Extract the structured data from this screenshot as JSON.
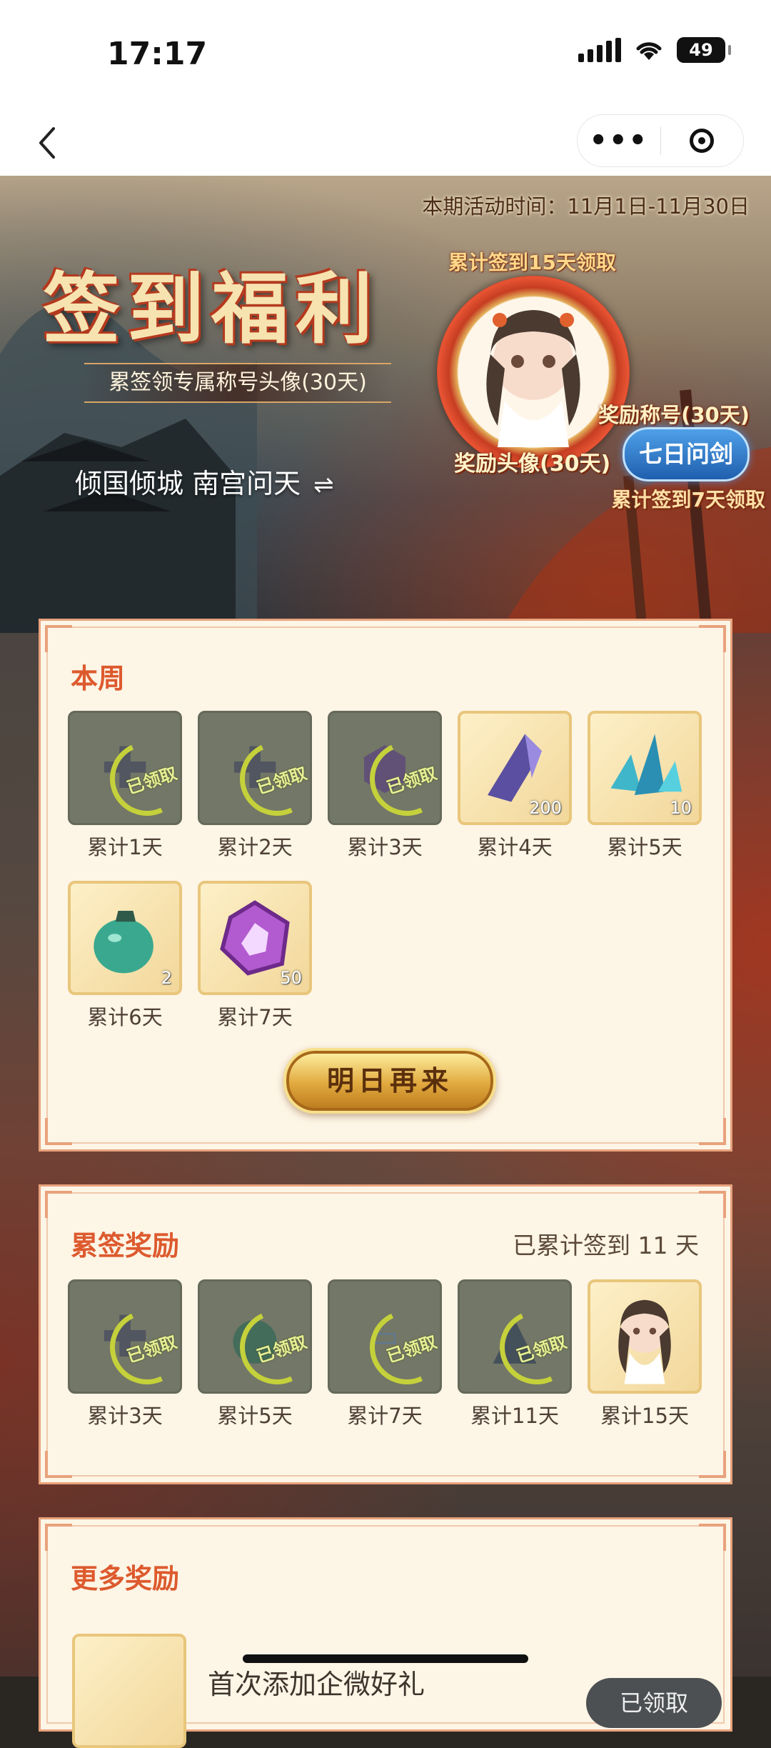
{
  "status_bar": {
    "time": "17:17",
    "battery": "49"
  },
  "nav": {
    "back_icon": "chevron-left-icon",
    "more_icon": "more-dots-icon",
    "close_icon": "target-icon"
  },
  "hero": {
    "event_time": "本期活动时间：11月1日-11月30日",
    "title": "签到福利",
    "subtitle": "累签领专属称号头像(30天)",
    "name": "倾国倾城 南宫问天",
    "avatar_requirement": "累计签到15天领取",
    "avatar_label": "奖励头像(30天)",
    "title_label": "奖励称号(30天)",
    "title_badge": "七日问剑",
    "title_requirement": "累计签到7天领取"
  },
  "weekly": {
    "heading": "本周",
    "button": "明日再来",
    "items": [
      {
        "label": "累计1天",
        "status": "已领取",
        "count": "",
        "icon": "scroll-icon"
      },
      {
        "label": "累计2天",
        "status": "已领取",
        "count": "",
        "icon": "scroll-icon"
      },
      {
        "label": "累计3天",
        "status": "已领取",
        "count": "",
        "icon": "token-icon"
      },
      {
        "label": "累计4天",
        "status": "",
        "count": "200",
        "icon": "crystal-icon"
      },
      {
        "label": "累计5天",
        "status": "",
        "count": "10",
        "icon": "crystal-cluster-icon"
      },
      {
        "label": "累计6天",
        "status": "",
        "count": "2",
        "icon": "jade-pouch-icon"
      },
      {
        "label": "累计7天",
        "status": "",
        "count": "50",
        "icon": "purple-token-icon"
      }
    ]
  },
  "cumulative": {
    "heading": "累签奖励",
    "summary": "已累计签到 11 天",
    "items": [
      {
        "label": "累计3天",
        "status": "已领取",
        "icon": "scroll-icon"
      },
      {
        "label": "累计5天",
        "status": "已领取",
        "icon": "jade-pouch-icon"
      },
      {
        "label": "累计7天",
        "status": "已领取",
        "icon": "title-badge-icon"
      },
      {
        "label": "累计11天",
        "status": "已领取",
        "icon": "cannon-icon"
      },
      {
        "label": "累计15天",
        "status": "",
        "icon": "avatar-icon"
      }
    ]
  },
  "more": {
    "heading": "更多奖励",
    "item_text": "首次添加企微好礼",
    "item_button": "已领取"
  }
}
